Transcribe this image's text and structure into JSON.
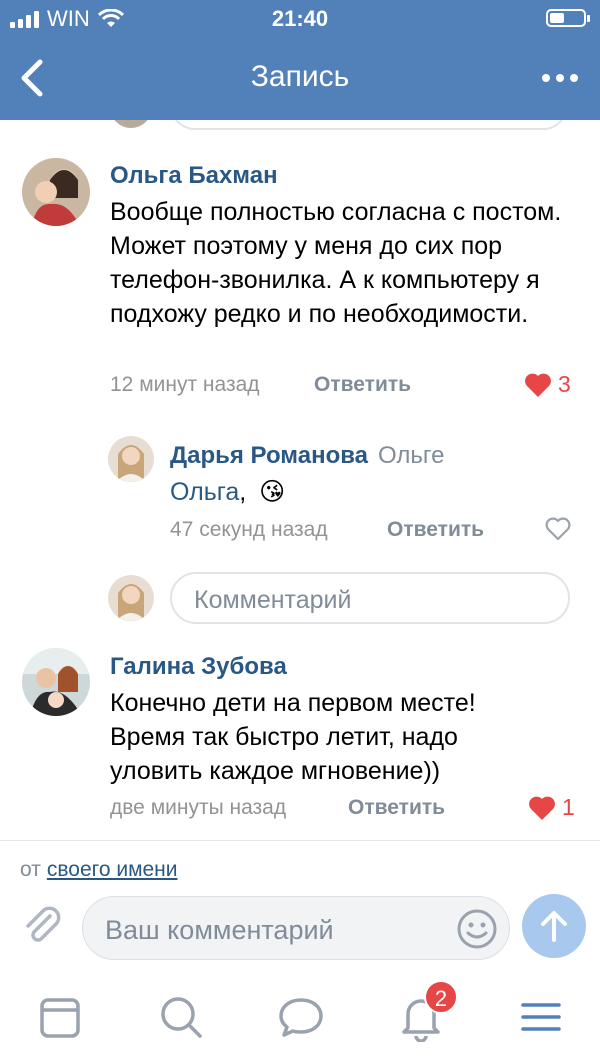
{
  "status_bar": {
    "carrier": "WIN",
    "time": "21:40"
  },
  "nav": {
    "title": "Запись"
  },
  "comments": [
    {
      "author": "Ольга Бахман",
      "text": "Вообще полностью согласна с постом. Может поэтому у меня до сих пор телефон-звонилка. А к компьютеру я подхожу редко и по необходимости.",
      "time": "12 минут назад",
      "reply_label": "Ответить",
      "likes": "3",
      "liked": true
    },
    {
      "author": "Дарья Романова",
      "reply_to": "Ольге",
      "mention": "Ольга",
      "text_suffix": ",",
      "emoji": "😘",
      "time": "47 секунд назад",
      "reply_label": "Ответить"
    },
    {
      "author": "Галина Зубова",
      "text": "Конечно дети на первом месте! Время так быстро летит, надо уловить каждое мгновение))",
      "time": "две минуты назад",
      "reply_label": "Ответить",
      "likes": "1",
      "liked": true
    }
  ],
  "thread_reply_input": {
    "placeholder": "Комментарий"
  },
  "composer": {
    "from_prefix": "от",
    "from_link": "своего имени",
    "placeholder": "Ваш комментарий"
  },
  "tabbar": {
    "items": [
      {
        "icon": "news-icon"
      },
      {
        "icon": "search-icon"
      },
      {
        "icon": "messages-icon"
      },
      {
        "icon": "notifications-icon",
        "badge": "2"
      },
      {
        "icon": "menu-icon"
      }
    ]
  },
  "colors": {
    "brand": "#5181b8",
    "link": "#2a5885",
    "like": "#e64646",
    "muted": "#818c99"
  }
}
